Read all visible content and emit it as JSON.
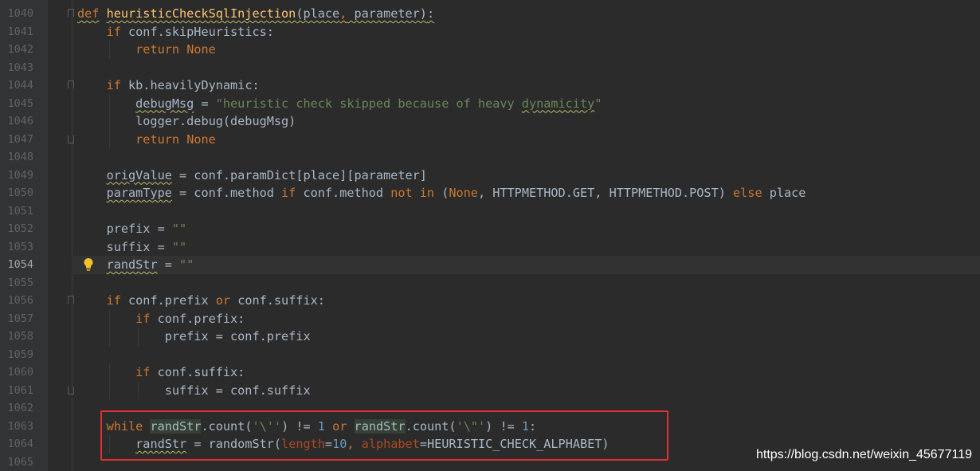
{
  "editor": {
    "lines": [
      {
        "num": "1040",
        "tokens": [
          {
            "t": "def",
            "c": "kw squig"
          },
          {
            "t": " "
          },
          {
            "t": "heuristicCheckSqlInjection",
            "c": "fn squig"
          },
          {
            "t": "(place",
            "c": "squig"
          },
          {
            "t": ",",
            "c": "kw squig"
          },
          {
            "t": " parameter)",
            "c": "squig"
          },
          {
            "t": ":",
            "c": "squig"
          }
        ]
      },
      {
        "num": "1041",
        "tokens": [
          {
            "t": "    "
          },
          {
            "t": "if",
            "c": "kw"
          },
          {
            "t": " conf.skipHeuristics:"
          }
        ]
      },
      {
        "num": "1042",
        "tokens": [
          {
            "t": "        "
          },
          {
            "t": "return",
            "c": "kw"
          },
          {
            "t": " "
          },
          {
            "t": "None",
            "c": "kw"
          }
        ]
      },
      {
        "num": "1043",
        "tokens": []
      },
      {
        "num": "1044",
        "tokens": [
          {
            "t": "    "
          },
          {
            "t": "if",
            "c": "kw"
          },
          {
            "t": " kb.heavilyDynamic:"
          }
        ]
      },
      {
        "num": "1045",
        "tokens": [
          {
            "t": "        "
          },
          {
            "t": "debugMsg",
            "c": "squig"
          },
          {
            "t": " = "
          },
          {
            "t": "\"heuristic check skipped because of heavy ",
            "c": "str"
          },
          {
            "t": "dynamicity",
            "c": "str squig"
          },
          {
            "t": "\"",
            "c": "str"
          }
        ]
      },
      {
        "num": "1046",
        "tokens": [
          {
            "t": "        logger.debug(debugMsg)"
          }
        ]
      },
      {
        "num": "1047",
        "tokens": [
          {
            "t": "        "
          },
          {
            "t": "return",
            "c": "kw"
          },
          {
            "t": " "
          },
          {
            "t": "None",
            "c": "kw"
          }
        ]
      },
      {
        "num": "1048",
        "tokens": []
      },
      {
        "num": "1049",
        "tokens": [
          {
            "t": "    "
          },
          {
            "t": "origValue",
            "c": "squig"
          },
          {
            "t": " = conf.paramDict[place][parameter]"
          }
        ]
      },
      {
        "num": "1050",
        "tokens": [
          {
            "t": "    "
          },
          {
            "t": "paramType",
            "c": "squig"
          },
          {
            "t": " = conf.method "
          },
          {
            "t": "if",
            "c": "kw"
          },
          {
            "t": " conf.method "
          },
          {
            "t": "not in",
            "c": "kw"
          },
          {
            "t": " ("
          },
          {
            "t": "None",
            "c": "kw"
          },
          {
            "t": ","
          },
          {
            "t": " HTTPMETHOD.GET"
          },
          {
            "t": ","
          },
          {
            "t": " HTTPMETHOD.POST) "
          },
          {
            "t": "else",
            "c": "kw"
          },
          {
            "t": " place"
          }
        ]
      },
      {
        "num": "1051",
        "tokens": []
      },
      {
        "num": "1052",
        "tokens": [
          {
            "t": "    prefix = "
          },
          {
            "t": "\"\"",
            "c": "str"
          }
        ]
      },
      {
        "num": "1053",
        "tokens": [
          {
            "t": "    suffix = "
          },
          {
            "t": "\"\"",
            "c": "str"
          }
        ]
      },
      {
        "num": "1054",
        "current": true,
        "bulb": true,
        "tokens": [
          {
            "t": "    "
          },
          {
            "t": "randStr",
            "c": "squig"
          },
          {
            "t": " = "
          },
          {
            "t": "\"\"",
            "c": "str"
          }
        ]
      },
      {
        "num": "1055",
        "tokens": []
      },
      {
        "num": "1056",
        "tokens": [
          {
            "t": "    "
          },
          {
            "t": "if",
            "c": "kw"
          },
          {
            "t": " conf.prefix "
          },
          {
            "t": "or",
            "c": "kw"
          },
          {
            "t": " conf.suffix:"
          }
        ]
      },
      {
        "num": "1057",
        "tokens": [
          {
            "t": "        "
          },
          {
            "t": "if",
            "c": "kw"
          },
          {
            "t": " conf.prefix:"
          }
        ]
      },
      {
        "num": "1058",
        "tokens": [
          {
            "t": "            prefix = conf.prefix"
          }
        ]
      },
      {
        "num": "1059",
        "tokens": []
      },
      {
        "num": "1060",
        "tokens": [
          {
            "t": "        "
          },
          {
            "t": "if",
            "c": "kw"
          },
          {
            "t": " conf.suffix:"
          }
        ]
      },
      {
        "num": "1061",
        "tokens": [
          {
            "t": "            suffix = conf.suffix"
          }
        ]
      },
      {
        "num": "1062",
        "tokens": []
      },
      {
        "num": "1063",
        "tokens": [
          {
            "t": "    "
          },
          {
            "t": "while",
            "c": "kw"
          },
          {
            "t": " "
          },
          {
            "t": "randStr",
            "c": "hl"
          },
          {
            "t": ".count("
          },
          {
            "t": "'\\''",
            "c": "str"
          },
          {
            "t": ") != "
          },
          {
            "t": "1",
            "c": "num"
          },
          {
            "t": " "
          },
          {
            "t": "or",
            "c": "kw"
          },
          {
            "t": " "
          },
          {
            "t": "randStr",
            "c": "hl"
          },
          {
            "t": ".count("
          },
          {
            "t": "'\\\"'",
            "c": "str"
          },
          {
            "t": ") != "
          },
          {
            "t": "1",
            "c": "num"
          },
          {
            "t": ":"
          }
        ]
      },
      {
        "num": "1064",
        "tokens": [
          {
            "t": "        "
          },
          {
            "t": "randStr",
            "c": "squig"
          },
          {
            "t": " = randomStr("
          },
          {
            "t": "length",
            "c": "kwarg"
          },
          {
            "t": "="
          },
          {
            "t": "10",
            "c": "num"
          },
          {
            "t": ", ",
            "c": "kw"
          },
          {
            "t": "alphabet",
            "c": "kwarg"
          },
          {
            "t": "=HEURISTIC_CHECK_ALPHABET)"
          }
        ]
      },
      {
        "num": "1065",
        "tokens": []
      }
    ]
  },
  "watermark": "https://blog.csdn.net/weixin_45677119",
  "colors": {
    "background": "#2b2b2b",
    "keyword": "#cc7832",
    "function": "#ffc66d",
    "string": "#6a8759",
    "number": "#6897bb",
    "highlight_box": "#e03030"
  }
}
